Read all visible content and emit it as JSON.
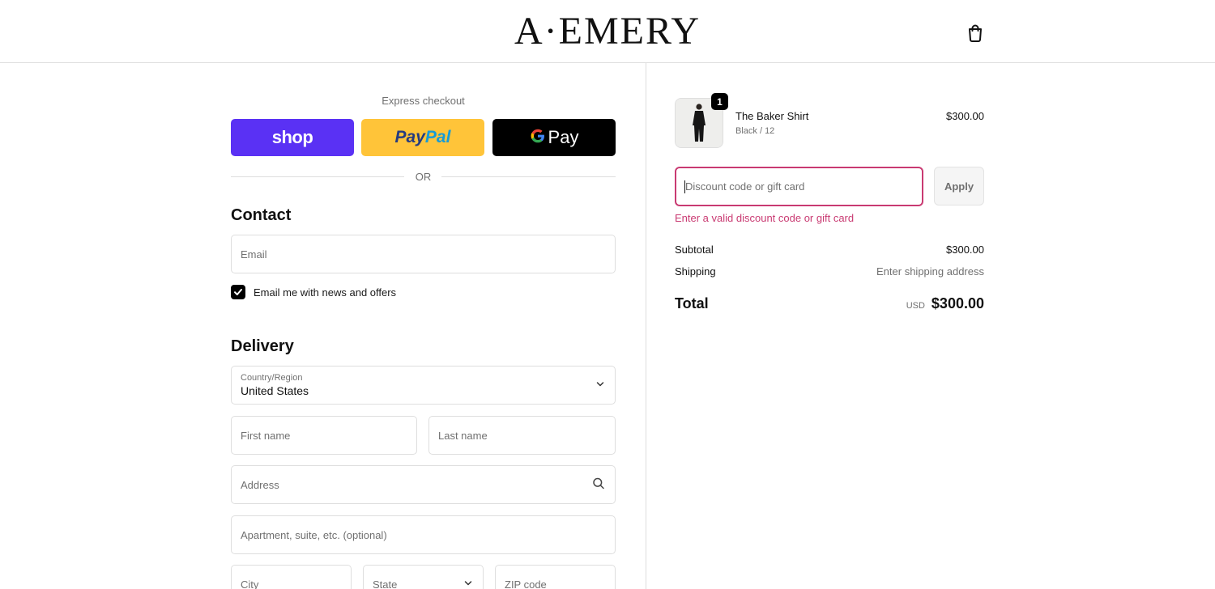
{
  "header": {
    "brand": "A·EMERY",
    "cart_icon": "shopping-bag-icon"
  },
  "express": {
    "label": "Express checkout",
    "shop_label": "shop",
    "paypal_label_1": "Pay",
    "paypal_label_2": "Pal",
    "gpay_label": "Pay",
    "colors": {
      "shop": "#5a31f4",
      "paypal": "#ffc439",
      "gpay": "#000000"
    }
  },
  "divider_or": "OR",
  "contact": {
    "title": "Contact",
    "email_placeholder": "Email",
    "newsletter_label": "Email me with news and offers",
    "newsletter_checked": true
  },
  "delivery": {
    "title": "Delivery",
    "country_label": "Country/Region",
    "country_value": "United States",
    "first_name_placeholder": "First name",
    "last_name_placeholder": "Last name",
    "address_placeholder": "Address",
    "apartment_placeholder": "Apartment, suite, etc. (optional)",
    "city_placeholder": "City",
    "state_placeholder": "State",
    "zip_placeholder": "ZIP code"
  },
  "order": {
    "item": {
      "name": "The Baker Shirt",
      "variant": "Black / 12",
      "price": "$300.00",
      "quantity": "1"
    },
    "discount": {
      "placeholder": "Discount code or gift card",
      "apply_label": "Apply",
      "error": "Enter a valid discount code or gift card",
      "error_color": "#c93a72"
    },
    "subtotal_label": "Subtotal",
    "subtotal_value": "$300.00",
    "shipping_label": "Shipping",
    "shipping_value": "Enter shipping address",
    "total_label": "Total",
    "total_currency": "USD",
    "total_value": "$300.00"
  }
}
